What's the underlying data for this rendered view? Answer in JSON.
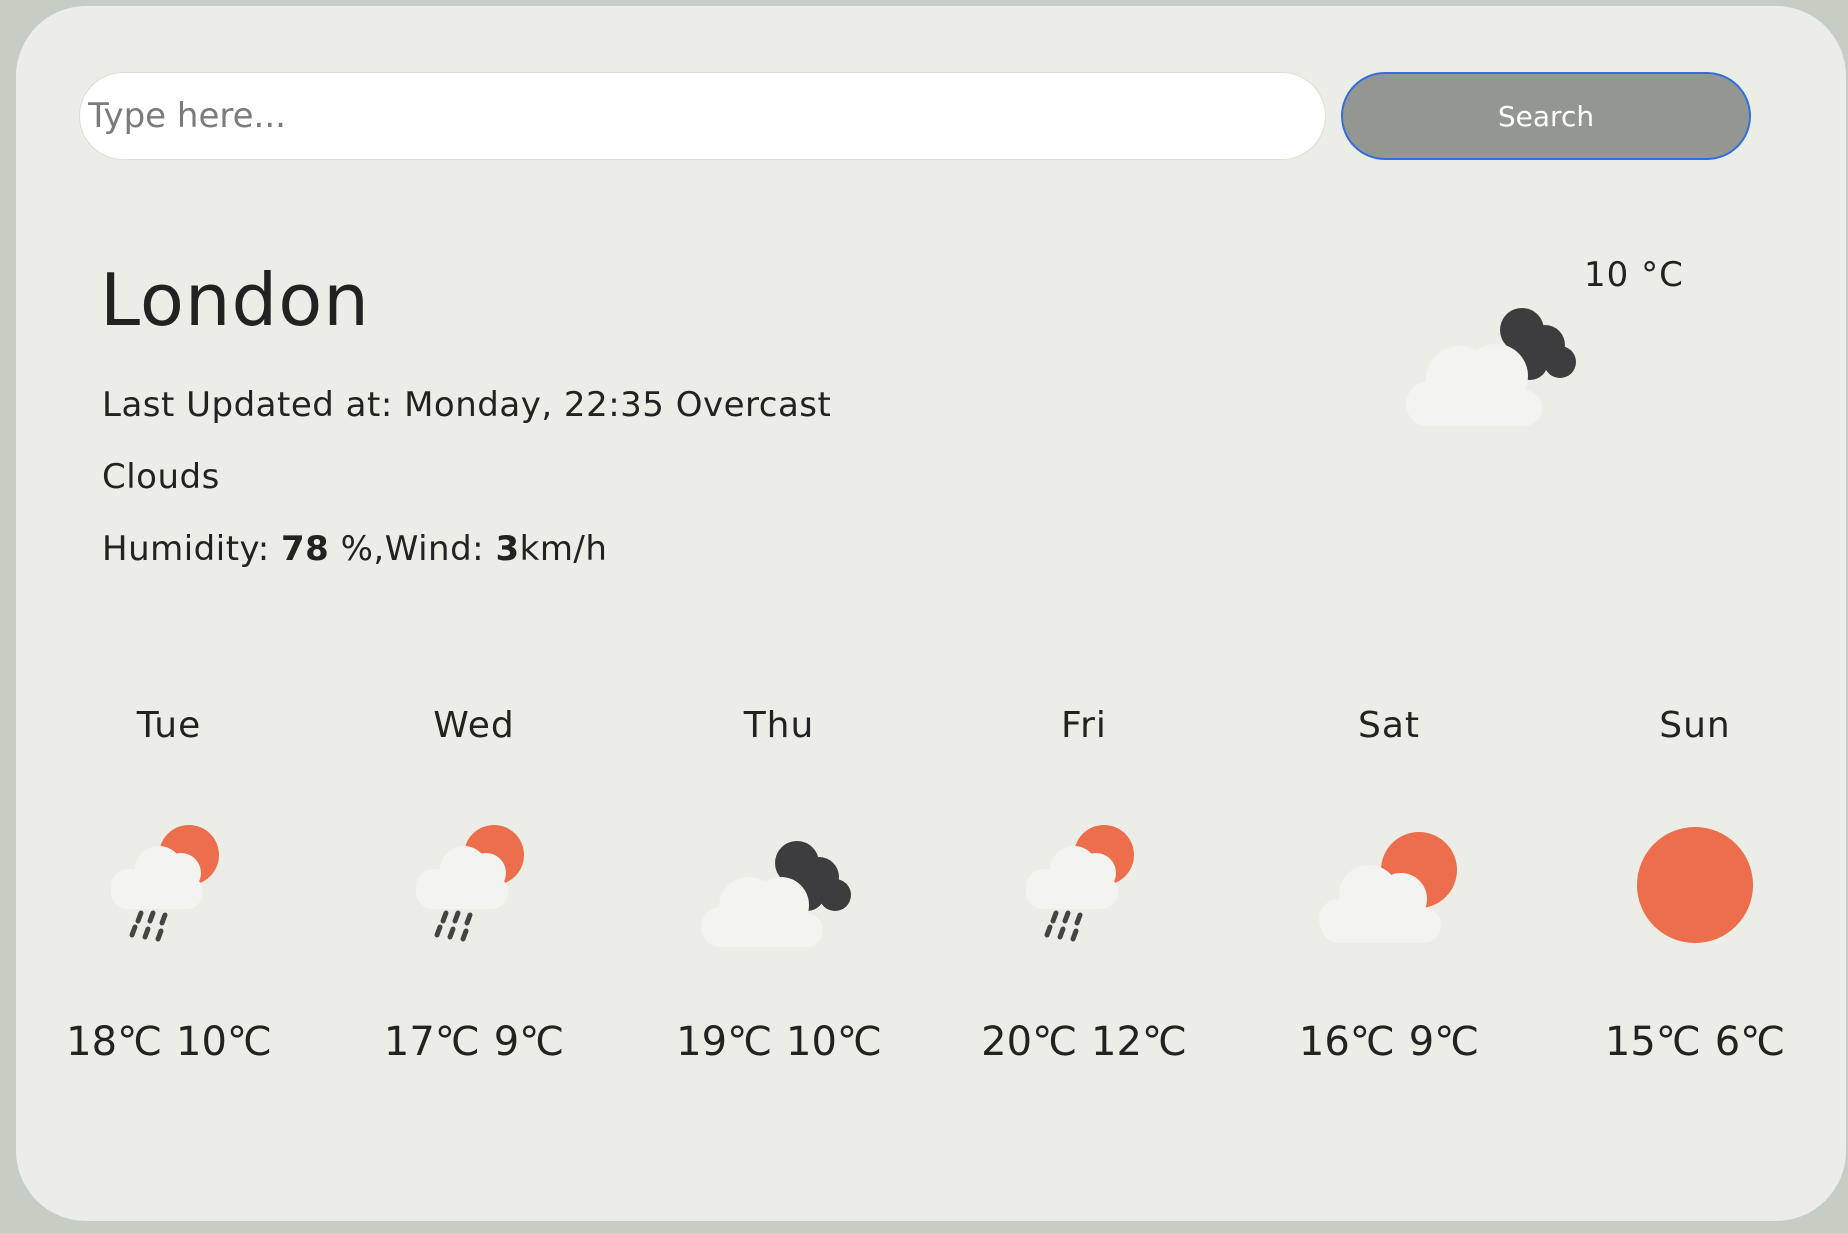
{
  "search": {
    "placeholder": "Type here...",
    "value": "",
    "button_label": "Search"
  },
  "current": {
    "city": "London",
    "last_updated_label": "Last Updated at:",
    "last_updated_value": "Monday, 22:35",
    "description_part1": "Overcast",
    "description_part2": "Clouds",
    "humidity_label": "Humidity:",
    "humidity_value": "78",
    "humidity_unit": "%,",
    "wind_label": "Wind:",
    "wind_value": "3",
    "wind_unit": "km/h",
    "temperature": "10 °C",
    "icon": "cloudy-icon"
  },
  "colors": {
    "sun": "#ec6e4c",
    "dark_cloud": "#3d3d3f",
    "light_cloud": "#f3f3f2",
    "rain": "#444444",
    "accent_border": "#2f6ee0",
    "button_bg": "#949791"
  },
  "forecast": [
    {
      "day": "Tue",
      "high": "18℃",
      "low": "10℃",
      "icon": "rain-sun-icon"
    },
    {
      "day": "Wed",
      "high": "17℃",
      "low": "9℃",
      "icon": "rain-sun-icon"
    },
    {
      "day": "Thu",
      "high": "19℃",
      "low": "10℃",
      "icon": "cloudy-icon"
    },
    {
      "day": "Fri",
      "high": "20℃",
      "low": "12℃",
      "icon": "rain-sun-icon"
    },
    {
      "day": "Sat",
      "high": "16℃",
      "low": "9℃",
      "icon": "partly-cloudy-icon"
    },
    {
      "day": "Sun",
      "high": "15℃",
      "low": "6℃",
      "icon": "sun-icon"
    }
  ]
}
